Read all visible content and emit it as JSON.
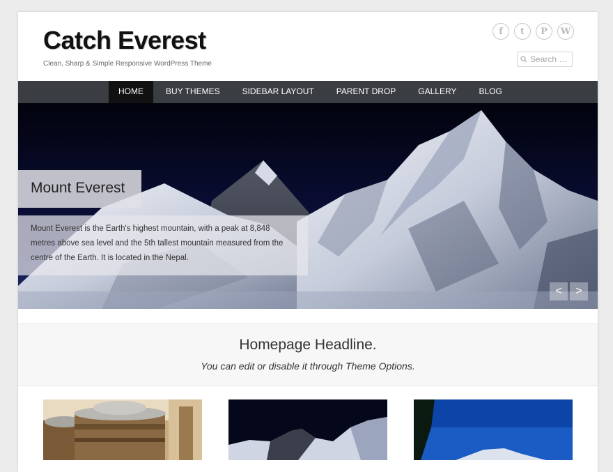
{
  "site": {
    "title": "Catch Everest",
    "description": "Clean, Sharp & Simple Responsive WordPress Theme"
  },
  "social": [
    {
      "name": "facebook-icon",
      "glyph": "f"
    },
    {
      "name": "twitter-icon",
      "glyph": "t"
    },
    {
      "name": "pinterest-icon",
      "glyph": "P"
    },
    {
      "name": "wordpress-icon",
      "glyph": "W"
    }
  ],
  "search": {
    "placeholder": "Search …"
  },
  "nav": {
    "items": [
      {
        "label": "HOME",
        "active": true
      },
      {
        "label": "BUY THEMES",
        "active": false
      },
      {
        "label": "SIDEBAR LAYOUT",
        "active": false
      },
      {
        "label": "PARENT DROP",
        "active": false
      },
      {
        "label": "GALLERY",
        "active": false
      },
      {
        "label": "BLOG",
        "active": false
      }
    ]
  },
  "slider": {
    "title": "Mount Everest",
    "excerpt": "Mount Everest is the Earth's highest mountain, with a peak at 8,848 metres above sea level and the 5th tallest mountain measured from the centre of the Earth. It is located in the Nepal.",
    "prev_label": "<",
    "next_label": ">"
  },
  "homepage": {
    "headline": "Homepage Headline.",
    "subheadline": "You can edit or disable it through Theme Options."
  },
  "featured": [
    {
      "name": "featured-image-prayer-wheels"
    },
    {
      "name": "featured-image-everest"
    },
    {
      "name": "featured-image-blue-sky-peak"
    }
  ],
  "colors": {
    "nav_bg": "#3a3d41",
    "nav_active": "#111111",
    "page_bg": "#ececec"
  }
}
